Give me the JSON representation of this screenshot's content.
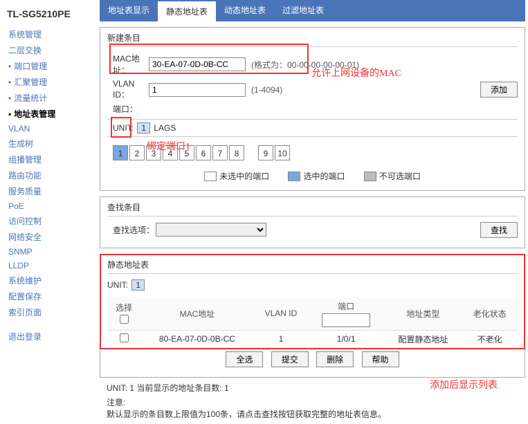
{
  "product": "TL-SG5210PE",
  "sidebar": {
    "items": [
      {
        "label": "系统管理",
        "bullet": false
      },
      {
        "label": "二层交换",
        "bullet": false
      },
      {
        "label": "端口管理",
        "bullet": true
      },
      {
        "label": "汇聚管理",
        "bullet": true
      },
      {
        "label": "流量统计",
        "bullet": true
      },
      {
        "label": "地址表管理",
        "bullet": true,
        "active": true
      },
      {
        "label": "VLAN",
        "bullet": false
      },
      {
        "label": "生成树",
        "bullet": false
      },
      {
        "label": "组播管理",
        "bullet": false
      },
      {
        "label": "路由功能",
        "bullet": false
      },
      {
        "label": "服务质量",
        "bullet": false
      },
      {
        "label": "PoE",
        "bullet": false
      },
      {
        "label": "访问控制",
        "bullet": false
      },
      {
        "label": "网络安全",
        "bullet": false
      },
      {
        "label": "SNMP",
        "bullet": false
      },
      {
        "label": "LLDP",
        "bullet": false
      },
      {
        "label": "系统维护",
        "bullet": false
      },
      {
        "label": "配置保存",
        "bullet": false
      },
      {
        "label": "索引页面",
        "bullet": false
      },
      {
        "label": "退出登录",
        "bullet": false
      }
    ]
  },
  "tabs": [
    {
      "label": "地址表显示"
    },
    {
      "label": "静态地址表",
      "active": true
    },
    {
      "label": "动态地址表"
    },
    {
      "label": "过滤地址表"
    }
  ],
  "new_entry": {
    "title": "新建条目",
    "mac_label": "MAC地址：",
    "mac_value": "30-EA-07-0D-0B-CC",
    "mac_hint": "(格式为：00-00-00-00-00-01)",
    "vlan_label": "VLAN ID：",
    "vlan_value": "1",
    "vlan_hint": "(1-4094)",
    "port_label": "端口：",
    "unit_label": "UNIT:",
    "unit_value": "1",
    "lags_label": "LAGS",
    "ports": [
      1,
      2,
      3,
      4,
      5,
      6,
      7,
      8,
      9,
      10
    ],
    "selected_port": 1,
    "add_btn": "添加",
    "legend": {
      "unselected": "未选中的端口",
      "selected": "选中的端口",
      "disabled": "不可选端口"
    }
  },
  "search": {
    "title": "查找条目",
    "opt_label": "查找选项：",
    "btn": "查找"
  },
  "table_panel": {
    "title": "静态地址表",
    "unit_label": "UNIT:",
    "unit_value": "1",
    "headers": {
      "select": "选择",
      "mac": "MAC地址",
      "vlan": "VLAN ID",
      "port": "端口",
      "type": "地址类型",
      "aging": "老化状态"
    },
    "rows": [
      {
        "mac": "80-EA-07-0D-0B-CC",
        "vlan": "1",
        "port": "1/0/1",
        "type": "配置静态地址",
        "aging": "不老化"
      }
    ],
    "btns": {
      "all": "全选",
      "submit": "提交",
      "del": "删除",
      "help": "帮助"
    }
  },
  "footer": {
    "summary": "UNIT:   1  当前显示的地址条目数: 1",
    "note_title": "注意:",
    "note_body": "默认显示的条目数上限值为100条，请点击查找按钮获取完整的地址表信息。"
  },
  "annotations": {
    "a1": "允许上网设备的MAC",
    "a2": "绑定端口1",
    "a3": "添加后显示列表"
  }
}
